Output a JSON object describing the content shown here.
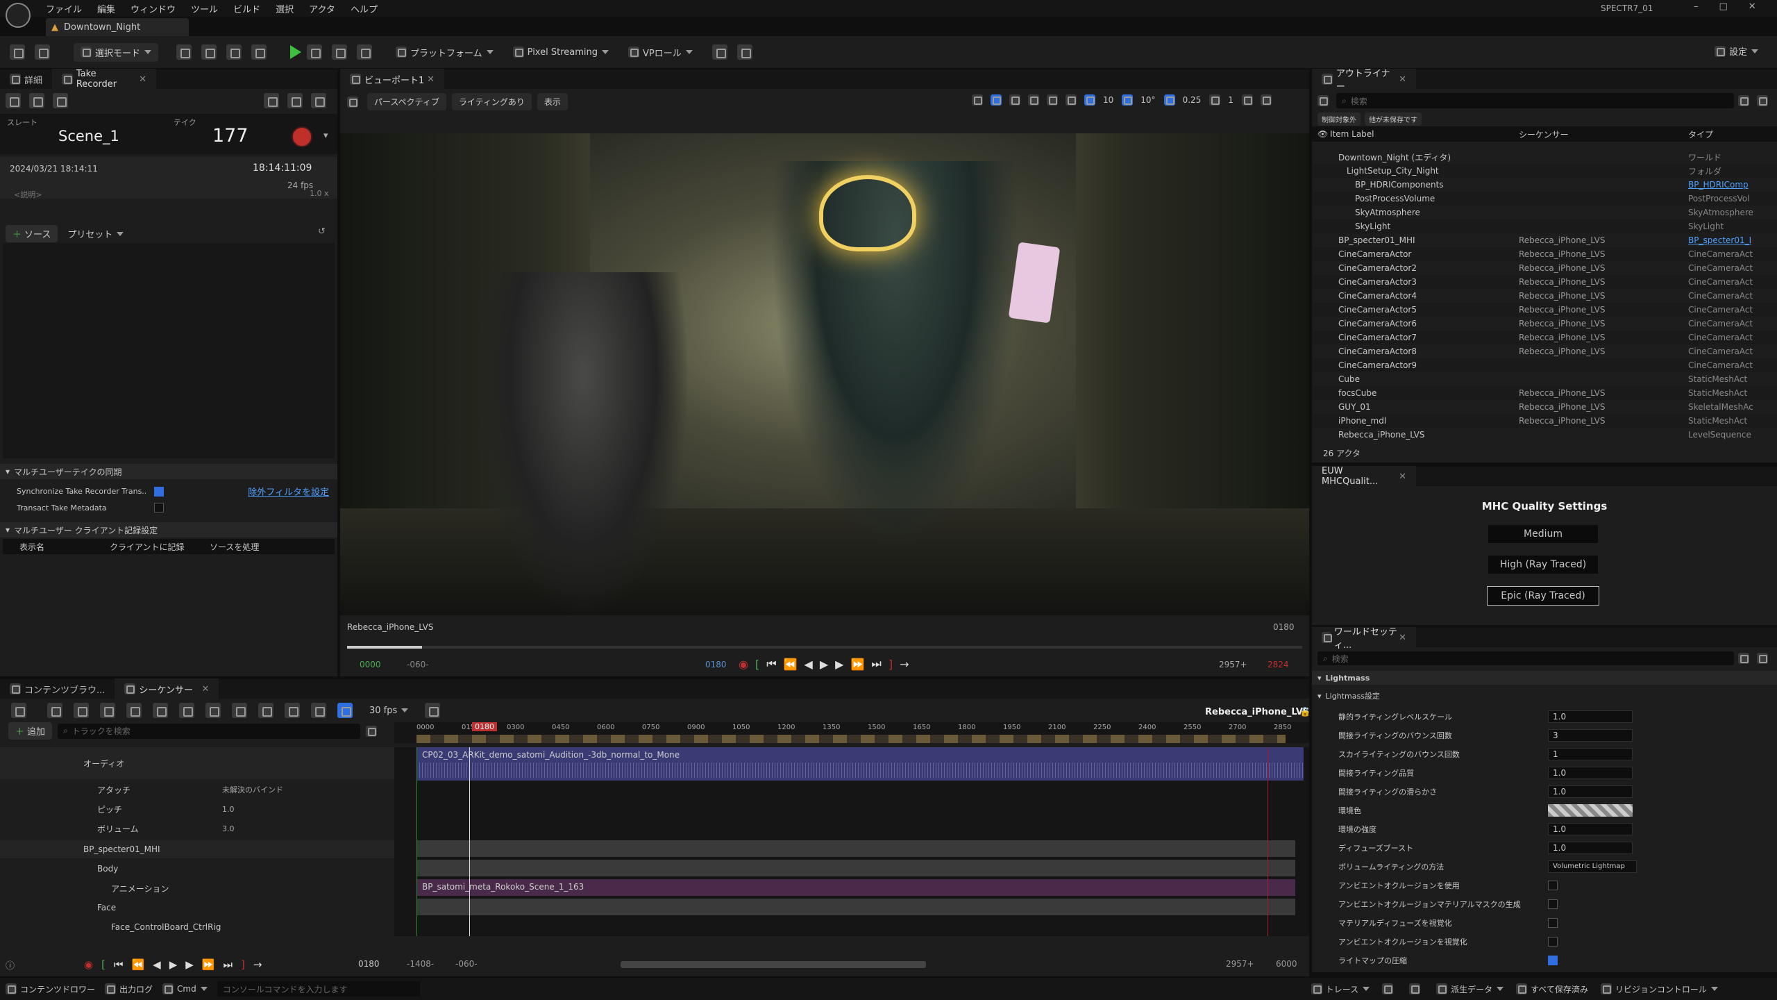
{
  "menu": {
    "items": [
      "ファイル",
      "編集",
      "ウィンドウ",
      "ツール",
      "ビルド",
      "選択",
      "アクタ",
      "ヘルプ"
    ],
    "project": "SPECTR7_01"
  },
  "level_tab": "Downtown_Night",
  "toolbar": {
    "select_mode": "選択モード",
    "platform": "プラットフォーム",
    "pixel_streaming": "Pixel Streaming",
    "vp_roles": "VPロール",
    "settings": "設定"
  },
  "left": {
    "tabs": [
      "詳細",
      "Take Recorder"
    ],
    "slate_label": "スレート",
    "take_label": "テイク",
    "slate": "Scene_1",
    "take": "177",
    "date": "2024/03/21 18:14:11",
    "timecode": "18:14:11:09",
    "fps": "24 fps",
    "desc_placeholder": "<説明>",
    "ratio": "1.0 x",
    "source_button": "ソース",
    "preset_button": "プリセット",
    "multi_user_sync": "マルチユーザーテイクの同期",
    "sync_label": "Synchronize Take Recorder Trans...",
    "exclude_filter": "除外フィルタを設定",
    "transact_label": "Transact Take Metadata",
    "client_settings": "マルチユーザー クライアント記録設定",
    "cols": [
      "表示名",
      "クライアントに記録",
      "ソースを処理"
    ]
  },
  "viewport": {
    "tab": "ビューポート1",
    "perspective": "パースペクティブ",
    "lighting": "ライティングあり",
    "show": "表示",
    "grid": "10",
    "angle": "10°",
    "scale": "0.25",
    "cam": "1",
    "seq_name": "Rebecca_iPhone_LVS",
    "frame_right": "0180",
    "start": "0000",
    "neg": "-060-",
    "cur": "0180",
    "end": "2957+",
    "end_red": "2824"
  },
  "outliner": {
    "tab": "アウトライナー",
    "search": "検索",
    "filter1": "制御対象外",
    "filter2": "他が未保存です",
    "col_label": "Item Label",
    "col_seq": "シーケンサー",
    "col_type": "タイプ",
    "rows": [
      {
        "label": "Downtown_Night (エディタ)",
        "seq": "",
        "type": "ワールド",
        "indent": 1
      },
      {
        "label": "LightSetup_City_Night",
        "seq": "",
        "type": "フォルダ",
        "indent": 2
      },
      {
        "label": "BP_HDRIComponents",
        "seq": "",
        "type": "BP_HDRIComp",
        "indent": 3,
        "link": true
      },
      {
        "label": "PostProcessVolume",
        "seq": "",
        "type": "PostProcessVol",
        "indent": 3
      },
      {
        "label": "SkyAtmosphere",
        "seq": "",
        "type": "SkyAtmosphere",
        "indent": 3
      },
      {
        "label": "SkyLight",
        "seq": "",
        "type": "SkyLight",
        "indent": 3
      },
      {
        "label": "BP_specter01_MHI",
        "seq": "Rebecca_iPhone_LVS",
        "type": "BP_specter01_I",
        "indent": 1,
        "link": true
      },
      {
        "label": "CineCameraActor",
        "seq": "Rebecca_iPhone_LVS",
        "type": "CineCameraAct",
        "indent": 1
      },
      {
        "label": "CineCameraActor2",
        "seq": "Rebecca_iPhone_LVS",
        "type": "CineCameraAct",
        "indent": 1
      },
      {
        "label": "CineCameraActor3",
        "seq": "Rebecca_iPhone_LVS",
        "type": "CineCameraAct",
        "indent": 1
      },
      {
        "label": "CineCameraActor4",
        "seq": "Rebecca_iPhone_LVS",
        "type": "CineCameraAct",
        "indent": 1
      },
      {
        "label": "CineCameraActor5",
        "seq": "Rebecca_iPhone_LVS",
        "type": "CineCameraAct",
        "indent": 1
      },
      {
        "label": "CineCameraActor6",
        "seq": "Rebecca_iPhone_LVS",
        "type": "CineCameraAct",
        "indent": 1
      },
      {
        "label": "CineCameraActor7",
        "seq": "Rebecca_iPhone_LVS",
        "type": "CineCameraAct",
        "indent": 1
      },
      {
        "label": "CineCameraActor8",
        "seq": "Rebecca_iPhone_LVS",
        "type": "CineCameraAct",
        "indent": 1
      },
      {
        "label": "CineCameraActor9",
        "seq": "",
        "type": "CineCameraAct",
        "indent": 1
      },
      {
        "label": "Cube",
        "seq": "",
        "type": "StaticMeshAct",
        "indent": 1
      },
      {
        "label": "focsCube",
        "seq": "Rebecca_iPhone_LVS",
        "type": "StaticMeshAct",
        "indent": 1
      },
      {
        "label": "GUY_01",
        "seq": "Rebecca_iPhone_LVS",
        "type": "SkeletalMeshAc",
        "indent": 1
      },
      {
        "label": "iPhone_mdl",
        "seq": "Rebecca_iPhone_LVS",
        "type": "StaticMeshAct",
        "indent": 1
      },
      {
        "label": "Rebecca_iPhone_LVS",
        "seq": "",
        "type": "LevelSequence",
        "indent": 1
      }
    ],
    "count": "26 アクタ"
  },
  "mhc": {
    "tab": "EUW MHCQualit...",
    "title": "MHC Quality Settings",
    "b1": "Medium",
    "b2": "High (Ray Traced)",
    "b3": "Epic (Ray Traced)"
  },
  "world": {
    "tab": "ワールドセッティ...",
    "search": "検索",
    "section": "Lightmass",
    "sub": "Lightmass設定",
    "rows": [
      {
        "label": "静的ライティングレベルスケール",
        "value": "1.0",
        "kind": "field"
      },
      {
        "label": "間接ライティングのバウンス回数",
        "value": "3",
        "kind": "field"
      },
      {
        "label": "スカイライティングのバウンス回数",
        "value": "1",
        "kind": "field"
      },
      {
        "label": "間接ライティング品質",
        "value": "1.0",
        "kind": "field"
      },
      {
        "label": "間接ライティングの滑らかさ",
        "value": "1.0",
        "kind": "field"
      },
      {
        "label": "環境色",
        "value": "",
        "kind": "color"
      },
      {
        "label": "環境の強度",
        "value": "1.0",
        "kind": "field"
      },
      {
        "label": "ディフューズブースト",
        "value": "1.0",
        "kind": "field"
      },
      {
        "label": "ボリュームライティングの方法",
        "value": "Volumetric Lightmap",
        "kind": "select"
      },
      {
        "label": "アンビエントオクルージョンを使用",
        "value": "",
        "kind": "check"
      },
      {
        "label": "アンビエントオクルージョンマテリアルマスクの生成",
        "value": "",
        "kind": "check"
      },
      {
        "label": "マテリアルディフューズを視覚化",
        "value": "",
        "kind": "check"
      },
      {
        "label": "アンビエントオクルージョンを視覚化",
        "value": "",
        "kind": "check"
      },
      {
        "label": "ライトマップの圧縮",
        "value": "",
        "kind": "checkon"
      }
    ]
  },
  "seq": {
    "tabs": [
      "コンテンツブラウ...",
      "シーケンサー"
    ],
    "fps": "30 fps",
    "name": "Rebecca_iPhone_LVS",
    "add": "追加",
    "search": "トラックを検索",
    "playhead": "0180",
    "ticks": [
      "0000",
      "0150",
      "0300",
      "0450",
      "0600",
      "0750",
      "0900",
      "1050",
      "1200",
      "1350",
      "1500",
      "1650",
      "1800",
      "1950",
      "2100",
      "2250",
      "2400",
      "2550",
      "2700",
      "2850"
    ],
    "tracks": [
      {
        "label": "オーディオ",
        "indent": 0,
        "value": ""
      },
      {
        "label": "アタッチ",
        "indent": 1,
        "value": "未解決のバインド"
      },
      {
        "label": "ピッチ",
        "indent": 1,
        "value": "1.0"
      },
      {
        "label": "ボリューム",
        "indent": 1,
        "value": "3.0"
      },
      {
        "label": "BP_specter01_MHI",
        "indent": 0,
        "value": ""
      },
      {
        "label": "Body",
        "indent": 1,
        "value": ""
      },
      {
        "label": "アニメーション",
        "indent": 2,
        "value": ""
      },
      {
        "label": "Face",
        "indent": 1,
        "value": ""
      },
      {
        "label": "Face_ControlBoard_CtrlRig",
        "indent": 2,
        "value": ""
      }
    ],
    "audio_clip": "CP02_03_ARKit_demo_satomi_Audition_-3db_normal_to_Mone",
    "anim_clip": "BP_satomi_meta_Rokoko_Scene_1_163",
    "bottom_cur": "0180",
    "bottom_l1": "-1408-",
    "bottom_l2": "-060-",
    "bottom_r1": "2957+",
    "bottom_r2": "6000"
  },
  "status": {
    "content_drawer": "コンテンツドロワー",
    "output_log": "出力ログ",
    "cmd": "Cmd",
    "console": "コンソールコマンドを入力します",
    "trace": "トレース",
    "derived": "派生データ",
    "save_all": "すべて保存済み",
    "revision": "リビジョンコントロール"
  }
}
